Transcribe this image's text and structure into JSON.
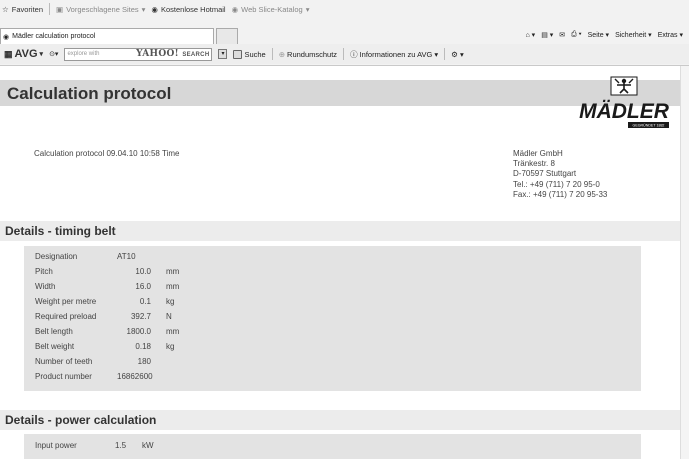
{
  "browser": {
    "favorites": {
      "label": "Favoriten",
      "suggested_sites": "Vorgeschlagene Sites",
      "hotmail": "Kostenlose Hotmail",
      "slice_gallery": "Web Slice-Katalog"
    },
    "tab_title": "Mädler calculation protocol",
    "command_bar": {
      "page": "Seite",
      "safety": "Sicherheit",
      "extras": "Extras"
    },
    "toolbar": {
      "avg": "AVG",
      "search_placeholder": "explore with",
      "yahoo": "YAHOO!",
      "yahoo_search": "SEARCH",
      "search_button": "Suche",
      "link_protection": "Rundumschutz",
      "avg_info": "Informationen zu AVG"
    }
  },
  "page": {
    "title": "Calculation protocol",
    "logo_text": "MÄDLER",
    "logo_tagline": "GEGRÜNDET 1882",
    "protocol_line": "Calculation protocol 09.04.10 10:58 Time",
    "address": {
      "company": "Mädler GmbH",
      "street": "Tränkestr. 8",
      "city": "D-70597 Stuttgart",
      "tel": "Tel.: +49 (711) 7 20 95-0",
      "fax": "Fax.: +49 (711) 7 20 95-33"
    }
  },
  "sections": {
    "timing_belt": {
      "title": "Details - timing belt",
      "rows": [
        {
          "label": "Designation",
          "value": "AT10",
          "unit": ""
        },
        {
          "label": "Pitch",
          "value": "10.0",
          "unit": "mm"
        },
        {
          "label": "Width",
          "value": "16.0",
          "unit": "mm"
        },
        {
          "label": "Weight per metre",
          "value": "0.1",
          "unit": "kg"
        },
        {
          "label": "Required preload",
          "value": "392.7",
          "unit": "N"
        },
        {
          "label": "Belt length",
          "value": "1800.0",
          "unit": "mm"
        },
        {
          "label": "Belt weight",
          "value": "0.18",
          "unit": "kg"
        },
        {
          "label": "Number of teeth",
          "value": "180",
          "unit": ""
        },
        {
          "label": "Product number",
          "value": "16862600",
          "unit": ""
        }
      ]
    },
    "power_calculation": {
      "title": "Details - power calculation",
      "rows": [
        {
          "label": "Input power",
          "value": "1.5",
          "unit": "kW"
        }
      ]
    }
  }
}
